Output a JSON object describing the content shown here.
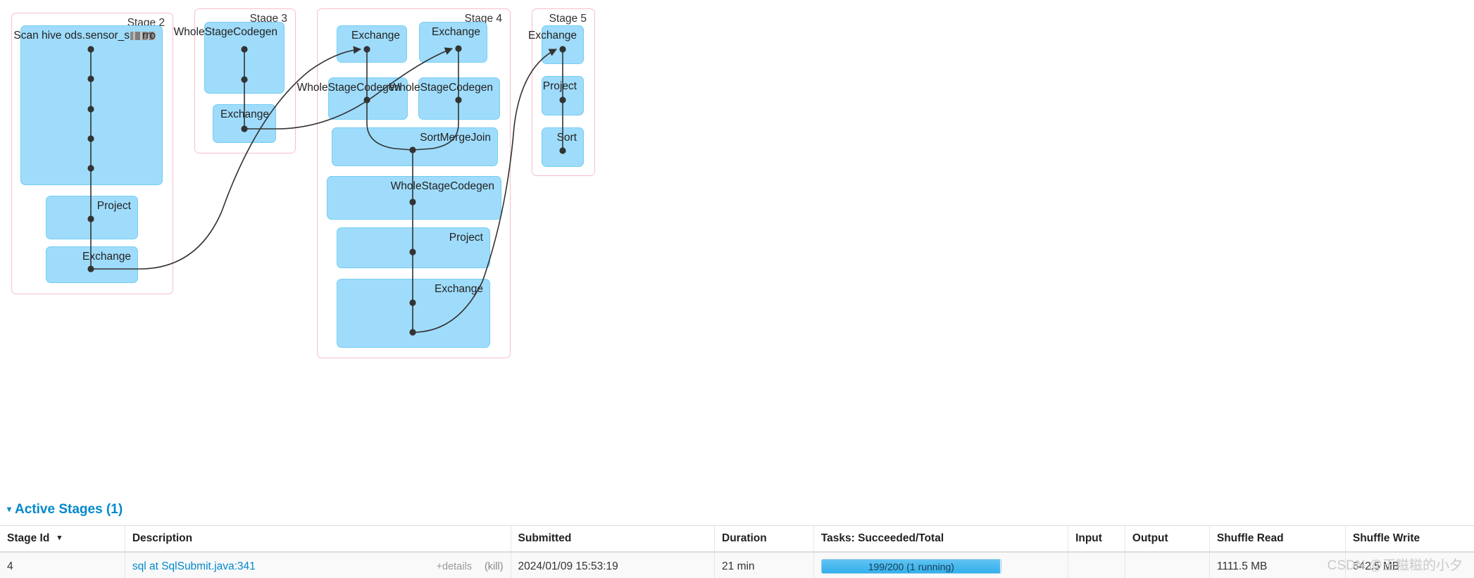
{
  "colors": {
    "node_fill": "#9fdcfb",
    "node_stroke": "#74cdf4",
    "cluster_stroke": "#f7bfc8",
    "edge": "#333333",
    "link": "#0088cc",
    "progress_fill": "#34b0ec",
    "watermark": "#c9c9c9"
  },
  "dag": {
    "stages": [
      {
        "label": "Stage 2",
        "nodes": [
          {
            "label": "Scan hive ods.sensor_s",
            "redacted": true,
            "suffix": "rro"
          },
          {
            "label": "Project"
          },
          {
            "label": "Exchange"
          }
        ]
      },
      {
        "label": "Stage 3",
        "nodes": [
          {
            "label": "WholeStageCodegen"
          },
          {
            "label": "Exchange"
          }
        ]
      },
      {
        "label": "Stage 4",
        "nodes": [
          {
            "label": "Exchange"
          },
          {
            "label": "Exchange"
          },
          {
            "label": "WholeStageCodegen"
          },
          {
            "label": "WholeStageCodegen"
          },
          {
            "label": "SortMergeJoin"
          },
          {
            "label": "WholeStageCodegen"
          },
          {
            "label": "Project"
          },
          {
            "label": "Exchange"
          }
        ]
      },
      {
        "label": "Stage 5",
        "nodes": [
          {
            "label": "Exchange"
          },
          {
            "label": "Project"
          },
          {
            "label": "Sort"
          }
        ]
      }
    ]
  },
  "active_stages": {
    "title": "Active Stages (1)",
    "caret": "▾",
    "columns": [
      {
        "label": "Stage Id",
        "sortable": true,
        "sort_caret": "▾"
      },
      {
        "label": "Description",
        "sortable": false
      },
      {
        "label": "Submitted",
        "sortable": false
      },
      {
        "label": "Duration",
        "sortable": false
      },
      {
        "label": "Tasks: Succeeded/Total",
        "sortable": false
      },
      {
        "label": "Input",
        "sortable": false
      },
      {
        "label": "Output",
        "sortable": false
      },
      {
        "label": "Shuffle Read",
        "sortable": false
      },
      {
        "label": "Shuffle Write",
        "sortable": false
      }
    ],
    "rows": [
      {
        "stage_id": "4",
        "description": "sql at SqlSubmit.java:341",
        "details_label": "+details",
        "kill_label": "(kill)",
        "submitted": "2024/01/09 15:53:19",
        "duration": "21 min",
        "tasks_text": "199/200 (1 running)",
        "tasks_succeeded": 199,
        "tasks_total": 200,
        "tasks_percent": 99.5,
        "input": "",
        "output": "",
        "shuffle_read": "1111.5 MB",
        "shuffle_write": "642.5 MB"
      }
    ]
  },
  "watermark": "CSDN @王糍糍的小夕"
}
